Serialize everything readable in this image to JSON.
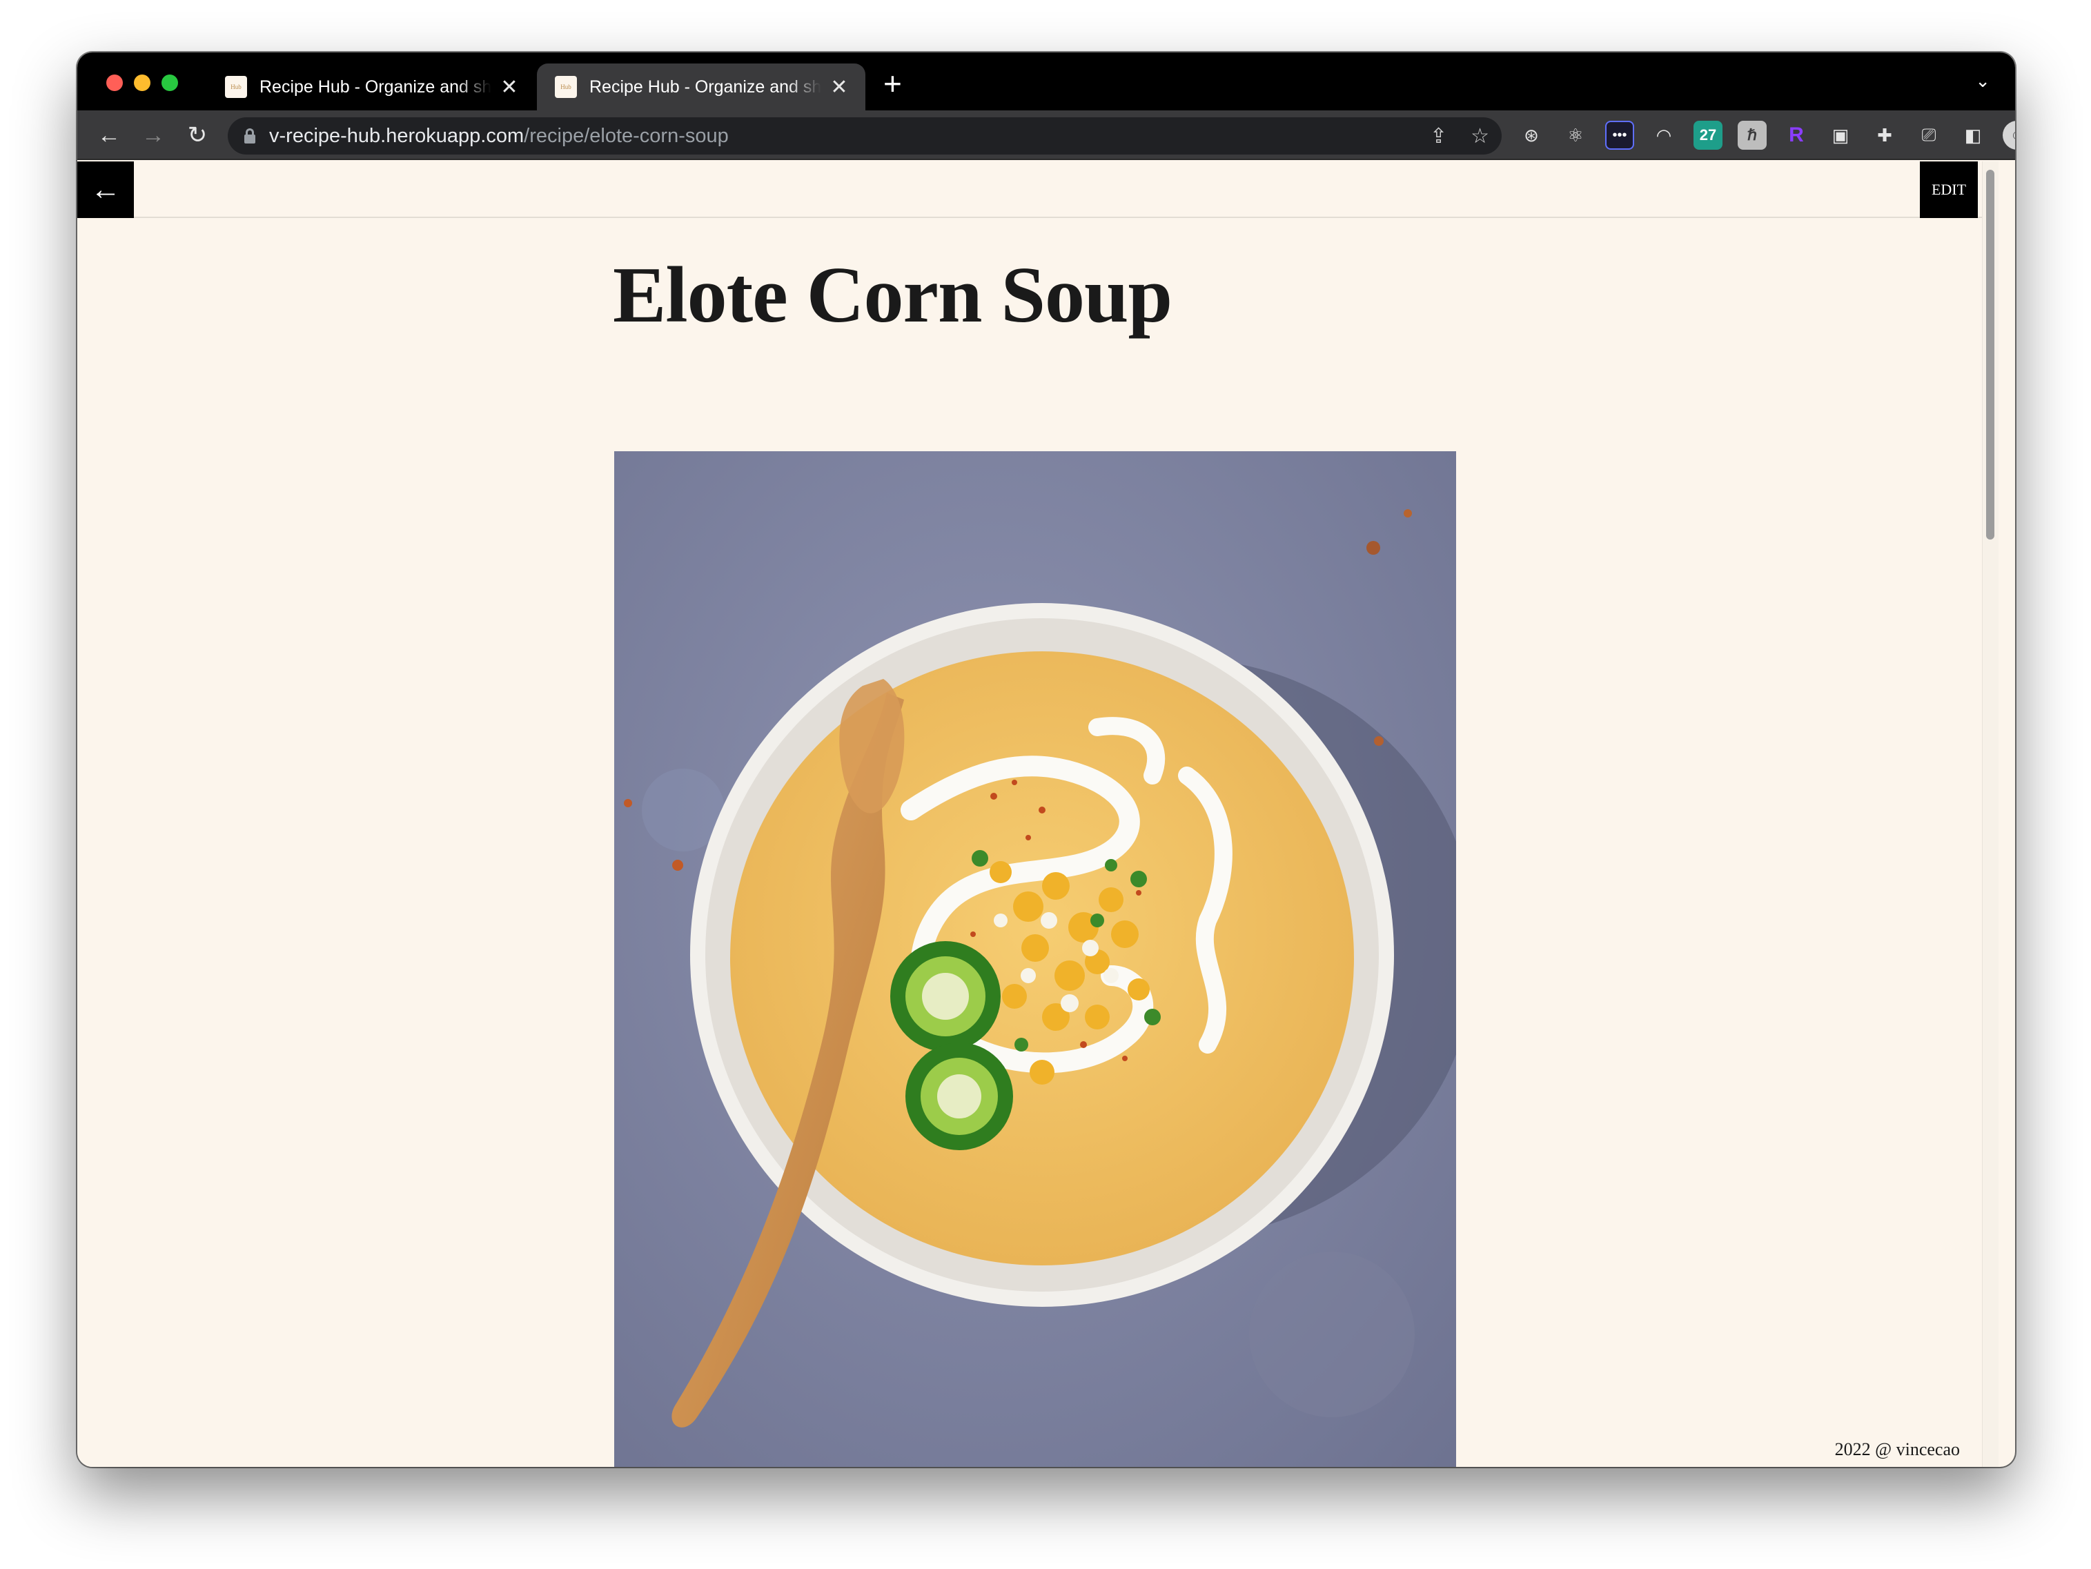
{
  "browser": {
    "tabs": [
      {
        "favicon_text": "Hub",
        "title": "Recipe Hub - Organize and share",
        "close": "✕"
      },
      {
        "favicon_text": "Hub",
        "title": "Recipe Hub - Organize and share",
        "close": "✕"
      }
    ],
    "new_tab": "+",
    "tab_menu": "⌄",
    "url_host": "v-recipe-hub.herokuapp.com",
    "url_path": "/recipe/elote-corn-soup",
    "extensions": [
      {
        "name": "openai-extension-icon",
        "glyph": "⊛"
      },
      {
        "name": "react-devtools-icon",
        "glyph": "⚛"
      },
      {
        "name": "dots-extension-icon",
        "glyph": "•••"
      },
      {
        "name": "arc-extension-icon",
        "glyph": "◠"
      },
      {
        "name": "calendar-27-extension-icon",
        "glyph": "27"
      },
      {
        "name": "h-extension-icon",
        "glyph": "ℏ"
      },
      {
        "name": "r-extension-icon",
        "glyph": "R"
      },
      {
        "name": "image-extension-icon",
        "glyph": "▣"
      },
      {
        "name": "puzzle-extensions-icon",
        "glyph": "✚"
      },
      {
        "name": "cast-icon",
        "glyph": "⎚"
      },
      {
        "name": "side-panel-icon",
        "glyph": "◧"
      },
      {
        "name": "profile-avatar",
        "glyph": "☺"
      },
      {
        "name": "kebab-menu-icon",
        "glyph": "⋮"
      }
    ]
  },
  "page": {
    "back_glyph": "←",
    "edit_label": "EDIT",
    "title": "Elote Corn Soup",
    "footer": "2022 @ vincecao"
  },
  "colors": {
    "page_bg": "#fcf5ec",
    "chrome_bg": "#000000",
    "toolbar_bg": "#3a3a3c",
    "button_bg": "#000000"
  }
}
